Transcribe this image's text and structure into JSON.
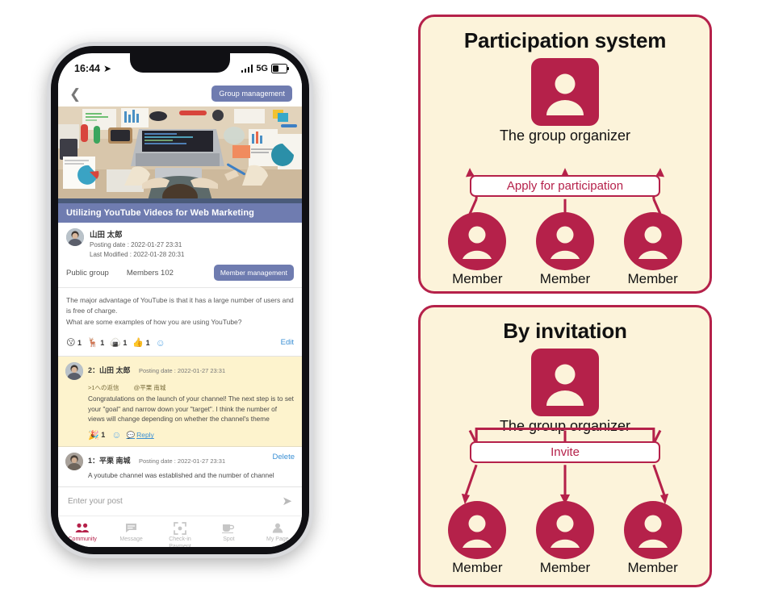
{
  "phone": {
    "status_bar": {
      "time": "16:44",
      "location_icon": "location-arrow-icon",
      "network": "5G",
      "signal_icon": "signal-bars-icon",
      "battery_icon": "battery-icon"
    },
    "nav": {
      "back_icon": "back-chevron-icon",
      "group_management_label": "Group management"
    },
    "hero": {
      "alt": "desk-photo-overhead-laptop"
    },
    "post": {
      "title": "Utilizing YouTube Videos for Web Marketing",
      "author": "山田 太郎",
      "posting_date": "Posting date : 2022-01-27 23:31",
      "last_modified": "Last Modified : 2022-01-28 20:31",
      "visibility": "Public group",
      "members": "Members 102",
      "member_management_label": "Member management",
      "body_line1": "The major advantage of YouTube is that it has a large number of users and is free of charge.",
      "body_line2": "What are some examples of how you are using YouTube?",
      "edit_label": "Edit",
      "reactions": [
        {
          "icon": "whistling-face-emoji",
          "glyph": "😗",
          "count": "1"
        },
        {
          "icon": "deer-emoji",
          "glyph": "🦌",
          "count": "1"
        },
        {
          "icon": "rice-ball-emoji",
          "glyph": "🍙",
          "count": "1"
        },
        {
          "icon": "thumbs-up-emoji",
          "glyph": "👍",
          "count": "1"
        }
      ],
      "add_reaction_icon": "add-reaction-icon"
    },
    "comments": [
      {
        "number_name": "2：山田 太郎",
        "date": "Posting date : 2022-01-27 23:31",
        "reply_to": ">1への返信",
        "mention": "@平栗 南城",
        "text": "Congratulations on the launch of your channel! The next step is to set your \"goal\" and narrow down your \"target\". I think the number of views will change depending on whether the channel's theme",
        "reaction_glyph": "🎉",
        "reaction_count": "1",
        "add_reaction_icon": "add-reaction-icon",
        "reply_label": "Reply"
      },
      {
        "number_name": "1：平栗 南城",
        "date": "Posting date : 2022-01-27 23:31",
        "delete_label": "Delete",
        "text": "A youtube channel was established and the number of channel"
      }
    ],
    "composer": {
      "placeholder": "Enter your post",
      "send_icon": "send-icon"
    },
    "tabbar": [
      {
        "icon": "community-people-icon",
        "label": "Community",
        "active": true
      },
      {
        "icon": "message-bubble-icon",
        "label": "Message",
        "active": false
      },
      {
        "icon": "checkin-scan-icon",
        "label": "Check-in\nPayment",
        "label_line1": "Check-in",
        "label_line2": "Payment",
        "active": false
      },
      {
        "icon": "spot-cup-icon",
        "label": "Spot",
        "active": false
      },
      {
        "icon": "my-page-person-icon",
        "label": "My Page",
        "active": false
      }
    ]
  },
  "diagram": {
    "accent_color": "#b5214a",
    "panel_bg": "#fcf3da",
    "panels": [
      {
        "title": "Participation system",
        "organizer_label": "The group organizer",
        "organizer_icon": "organizer-avatar-icon",
        "flow_label": "Apply for participation",
        "arrow_direction": "up",
        "members": [
          {
            "icon": "member-avatar-icon",
            "label": "Member"
          },
          {
            "icon": "member-avatar-icon",
            "label": "Member"
          },
          {
            "icon": "member-avatar-icon",
            "label": "Member"
          }
        ]
      },
      {
        "title": "By invitation",
        "organizer_label": "The group organizer",
        "organizer_icon": "organizer-avatar-icon",
        "flow_label": "Invite",
        "arrow_direction": "down",
        "members": [
          {
            "icon": "member-avatar-icon",
            "label": "Member"
          },
          {
            "icon": "member-avatar-icon",
            "label": "Member"
          },
          {
            "icon": "member-avatar-icon",
            "label": "Member"
          }
        ]
      }
    ]
  }
}
